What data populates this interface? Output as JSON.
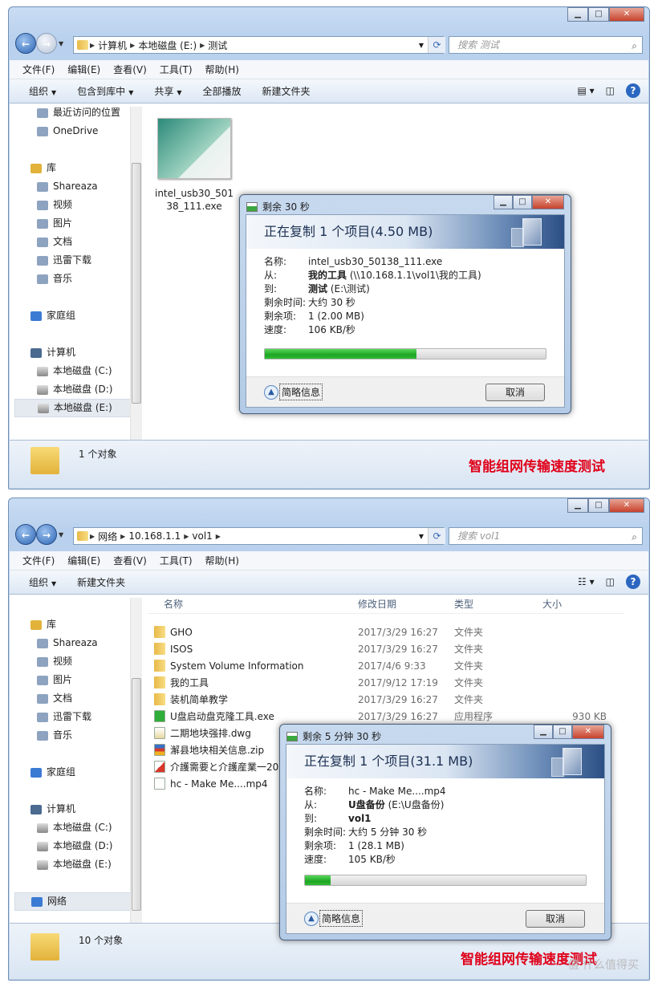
{
  "window1": {
    "path": [
      "计算机",
      "本地磁盘 (E:)",
      "测试"
    ],
    "search_placeholder": "搜索 测试",
    "menu": [
      "文件(F)",
      "编辑(E)",
      "查看(V)",
      "工具(T)",
      "帮助(H)"
    ],
    "toolbar": [
      "组织",
      "包含到库中",
      "共享",
      "全部播放",
      "新建文件夹"
    ],
    "sidebar": [
      [
        "最近访问的位置",
        "OneDrive"
      ],
      [
        "库",
        "Shareaza",
        "视频",
        "图片",
        "文档",
        "迅雷下载",
        "音乐"
      ],
      [
        "家庭组"
      ],
      [
        "计算机",
        "本地磁盘 (C:)",
        "本地磁盘 (D:)",
        "本地磁盘 (E:)"
      ]
    ],
    "selected_sidebar": "本地磁盘 (E:)",
    "file": {
      "name_line1": "intel_usb30_501",
      "name_line2": "38_111.exe"
    },
    "status": "1 个对象",
    "caption": "智能组网传输速度测试"
  },
  "dialog1": {
    "title": "剩余 30 秒",
    "heading": "正在复制 1 个项目(4.50 MB)",
    "name_label": "名称:",
    "name": "intel_usb30_50138_111.exe",
    "from_label": "从:",
    "from_bold": "我的工具",
    "from_path": " (\\\\10.168.1.1\\vol1\\我的工具)",
    "to_label": "到:",
    "to_bold": "测试",
    "to_path": " (E:\\测试)",
    "time_label": "剩余时间:",
    "time": "大约 30 秒",
    "items_label": "剩余项:",
    "items": "1 (2.00 MB)",
    "speed_label": "速度:",
    "speed": "106 KB/秒",
    "progress_percent": 54,
    "less_info": "简略信息",
    "cancel": "取消"
  },
  "window2": {
    "path": [
      "网络",
      "10.168.1.1",
      "vol1"
    ],
    "search_placeholder": "搜索 vol1",
    "menu": [
      "文件(F)",
      "编辑(E)",
      "查看(V)",
      "工具(T)",
      "帮助(H)"
    ],
    "toolbar": [
      "组织",
      "新建文件夹"
    ],
    "sidebar": [
      [
        "库",
        "Shareaza",
        "视频",
        "图片",
        "文档",
        "迅雷下载",
        "音乐"
      ],
      [
        "家庭组"
      ],
      [
        "计算机",
        "本地磁盘 (C:)",
        "本地磁盘 (D:)",
        "本地磁盘 (E:)"
      ],
      [
        "网络"
      ]
    ],
    "selected_sidebar": "网络",
    "columns": [
      "名称",
      "修改日期",
      "类型",
      "大小"
    ],
    "rows": [
      {
        "name": "GHO",
        "date": "2017/3/29 16:27",
        "type": "文件夹",
        "size": "",
        "icon": "folder"
      },
      {
        "name": "ISOS",
        "date": "2017/3/29 16:27",
        "type": "文件夹",
        "size": "",
        "icon": "folder"
      },
      {
        "name": "System Volume Information",
        "date": "2017/4/6 9:33",
        "type": "文件夹",
        "size": "",
        "icon": "folder"
      },
      {
        "name": "我的工具",
        "date": "2017/9/12 17:19",
        "type": "文件夹",
        "size": "",
        "icon": "folder"
      },
      {
        "name": "装机简单教学",
        "date": "2017/3/29 16:27",
        "type": "文件夹",
        "size": "",
        "icon": "folder"
      },
      {
        "name": "U盘启动盘克隆工具.exe",
        "date": "2017/3/29 16:27",
        "type": "应用程序",
        "size": "930 KB",
        "icon": "exe"
      },
      {
        "name": "二期地块强排.dwg",
        "date": "",
        "type": "",
        "size": "",
        "icon": "dwg"
      },
      {
        "name": "澥县地块相关信息.zip",
        "date": "",
        "type": "",
        "size": "",
        "icon": "zip"
      },
      {
        "name": "介護需要と介護産業一20",
        "date": "",
        "type": "",
        "size": "",
        "icon": "pdf"
      },
      {
        "name": "hc - Make Me....mp4",
        "date": "",
        "type": "",
        "size": "",
        "icon": "video"
      }
    ],
    "status": "10 个对象",
    "caption": "智能组网传输速度测试",
    "watermark": "值 什么值得买"
  },
  "dialog2": {
    "title": "剩余 5 分钟 30 秒",
    "heading": "正在复制 1 个项目(31.1 MB)",
    "name_label": "名称:",
    "name": "hc - Make Me....mp4",
    "from_label": "从:",
    "from_bold": "U盘备份",
    "from_path": " (E:\\U盘备份)",
    "to_label": "到:",
    "to_bold": "vol1",
    "to_path": "",
    "time_label": "剩余时间:",
    "time": "大约 5 分钟 30 秒",
    "items_label": "剩余项:",
    "items": "1 (28.1 MB)",
    "speed_label": "速度:",
    "speed": "105 KB/秒",
    "progress_percent": 9,
    "less_info": "简略信息",
    "cancel": "取消"
  },
  "colors": {
    "progress": "#1ea524",
    "caption": "#e0001a",
    "close": "#c7432c"
  }
}
